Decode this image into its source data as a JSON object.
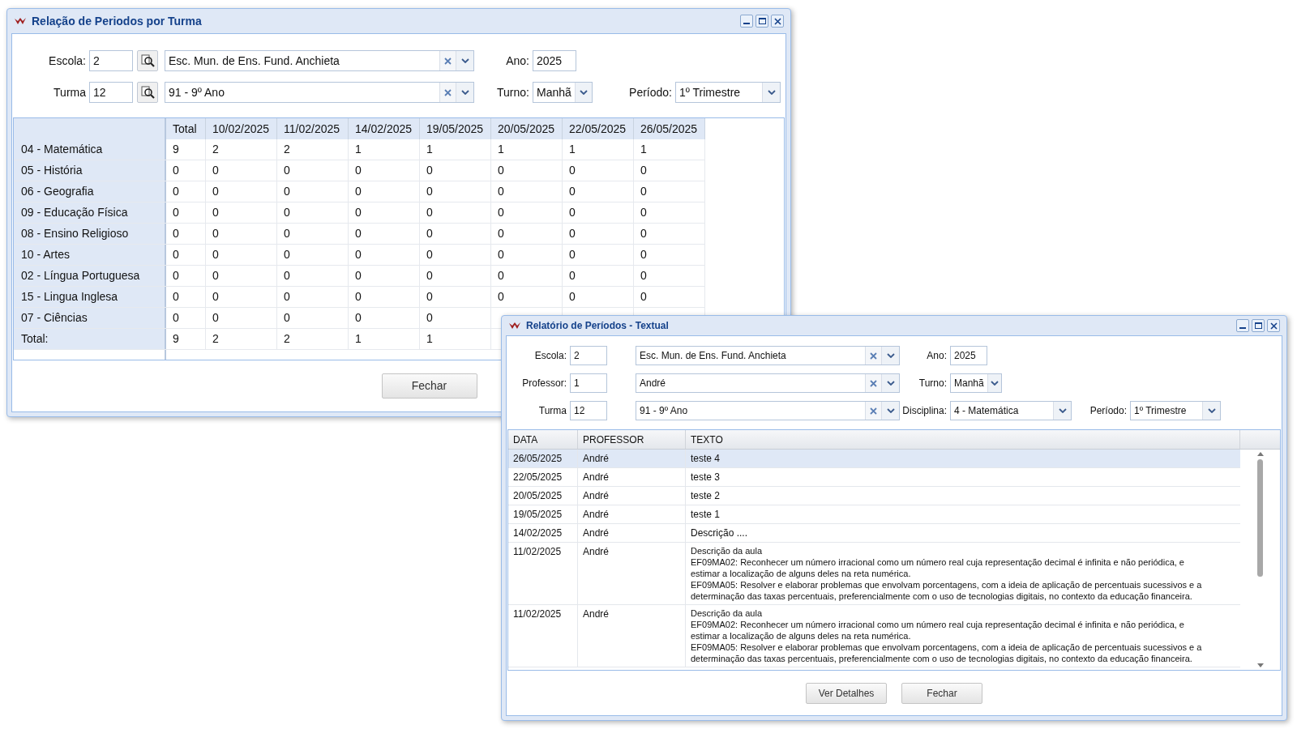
{
  "report_window": {
    "title": "Relação de Periodos por Turma",
    "escola": {
      "label": "Escola:",
      "code": "2",
      "name": "Esc. Mun. de Ens. Fund. Anchieta"
    },
    "ano": {
      "label": "Ano:",
      "value": "2025"
    },
    "turma": {
      "label": "Turma",
      "code": "12",
      "name": "91 - 9º Ano"
    },
    "turno": {
      "label": "Turno:",
      "value": "Manhã"
    },
    "periodo": {
      "label": "Período:",
      "value": "1º Trimestre"
    },
    "table": {
      "columns": [
        "Total",
        "10/02/2025",
        "11/02/2025",
        "14/02/2025",
        "19/05/2025",
        "20/05/2025",
        "22/05/2025",
        "26/05/2025"
      ],
      "rows": [
        {
          "label": "04 - Matemática",
          "cells": [
            "9",
            "2",
            "2",
            "1",
            "1",
            "1",
            "1",
            "1"
          ]
        },
        {
          "label": "05 - História",
          "cells": [
            "0",
            "0",
            "0",
            "0",
            "0",
            "0",
            "0",
            "0"
          ]
        },
        {
          "label": "06 - Geografia",
          "cells": [
            "0",
            "0",
            "0",
            "0",
            "0",
            "0",
            "0",
            "0"
          ]
        },
        {
          "label": "09 - Educação Física",
          "cells": [
            "0",
            "0",
            "0",
            "0",
            "0",
            "0",
            "0",
            "0"
          ]
        },
        {
          "label": "08 - Ensino Religioso",
          "cells": [
            "0",
            "0",
            "0",
            "0",
            "0",
            "0",
            "0",
            "0"
          ]
        },
        {
          "label": "10 - Artes",
          "cells": [
            "0",
            "0",
            "0",
            "0",
            "0",
            "0",
            "0",
            "0"
          ]
        },
        {
          "label": "02 - Língua Portuguesa",
          "cells": [
            "0",
            "0",
            "0",
            "0",
            "0",
            "0",
            "0",
            "0"
          ]
        },
        {
          "label": "15 - Lingua Inglesa",
          "cells": [
            "0",
            "0",
            "0",
            "0",
            "0",
            "0",
            "0",
            "0"
          ]
        },
        {
          "label": "07 - Ciências",
          "cells": [
            "0",
            "0",
            "0",
            "0",
            "0"
          ]
        },
        {
          "label": "Total:",
          "cells": [
            "9",
            "2",
            "2",
            "1",
            "1"
          ]
        }
      ]
    },
    "buttons": [
      "Fechar"
    ]
  },
  "textual_window": {
    "title": "Relatório de Períodos - Textual",
    "escola": {
      "label": "Escola:",
      "code": "2",
      "name": "Esc. Mun. de Ens. Fund. Anchieta"
    },
    "ano": {
      "label": "Ano:",
      "value": "2025"
    },
    "professor": {
      "label": "Professor:",
      "code": "1",
      "name": "André"
    },
    "turno": {
      "label": "Turno:",
      "value": "Manhã"
    },
    "turma": {
      "label": "Turma",
      "code": "12",
      "name": "91 - 9º Ano"
    },
    "disciplina": {
      "label": "Disciplina:",
      "value": "4 - Matemática"
    },
    "periodo": {
      "label": "Período:",
      "value": "1º Trimestre"
    },
    "table": {
      "columns": [
        "DATA",
        "PROFESSOR",
        "TEXTO"
      ],
      "rows": [
        {
          "data": "26/05/2025",
          "professor": "André",
          "texto": [
            "teste 4"
          ],
          "selected": true
        },
        {
          "data": "22/05/2025",
          "professor": "André",
          "texto": [
            "teste 3"
          ],
          "selected": false
        },
        {
          "data": "20/05/2025",
          "professor": "André",
          "texto": [
            "teste 2"
          ],
          "selected": false
        },
        {
          "data": "19/05/2025",
          "professor": "André",
          "texto": [
            "teste 1"
          ],
          "selected": false
        },
        {
          "data": "14/02/2025",
          "professor": "André",
          "texto": [
            "Descrição ...."
          ],
          "selected": false
        },
        {
          "data": "11/02/2025",
          "professor": "André",
          "texto": [
            "Descrição da aula",
            "EF09MA02: Reconhecer um número irracional como um número real cuja representação decimal é infinita e não periódica, e",
            "estimar a localização de alguns deles na reta numérica.",
            "EF09MA05: Resolver e elaborar problemas que envolvam porcentagens, com a ideia de aplicação de percentuais sucessivos e a",
            "determinação das taxas percentuais, preferencialmente com o uso de tecnologias digitais, no contexto da educação financeira."
          ],
          "selected": false
        },
        {
          "data": "11/02/2025",
          "professor": "André",
          "texto": [
            "Descrição da aula",
            "EF09MA02: Reconhecer um número irracional como um número real cuja representação decimal é infinita e não periódica, e",
            "estimar a localização de alguns deles na reta numérica.",
            "EF09MA05: Resolver e elaborar problemas que envolvam porcentagens, com a ideia de aplicação de percentuais sucessivos e a",
            "determinação das taxas percentuais, preferencialmente com o uso de tecnologias digitais, no contexto da educação financeira."
          ],
          "selected": false
        }
      ]
    },
    "buttons": [
      "Ver Detalhes",
      "Fechar"
    ]
  }
}
